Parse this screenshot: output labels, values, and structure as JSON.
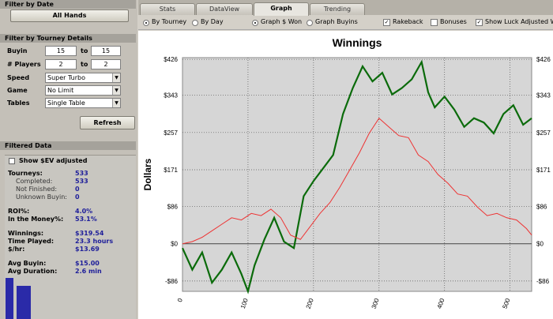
{
  "left": {
    "filter_date_title": "Filter by Date",
    "all_hands_label": "All Hands",
    "tourney_title": "Filter by Tourney Details",
    "buyin_label": "Buyin",
    "buyin_from": "15",
    "buyin_to_label": "to",
    "buyin_to": "15",
    "players_label": "# Players",
    "players_from": "2",
    "players_to_label": "to",
    "players_to": "2",
    "speed_label": "Speed",
    "speed_value": "Super Turbo",
    "game_label": "Game",
    "game_value": "No Limit",
    "tables_label": "Tables",
    "tables_value": "Single Table",
    "refresh_label": "Refresh",
    "filtered_title": "Filtered Data",
    "show_ev_label": "Show $EV adjusted",
    "stats": {
      "tourneys_label": "Tourneys:",
      "tourneys": "533",
      "completed_label": "Completed:",
      "completed": "533",
      "not_finished_label": "Not Finished:",
      "not_finished": "0",
      "unknown_label": "Unknown Buyin:",
      "unknown": "0",
      "roi_label": "ROI%:",
      "roi": "4.0%",
      "itm_label": "In the Money%:",
      "itm": "53.1%",
      "winnings_label": "Winnings:",
      "winnings": "$319.54",
      "time_label": "Time Played:",
      "time": "23.3 hours",
      "hr_label": "$/hr:",
      "hr": "$13.69",
      "avg_buyin_label": "Avg Buyin:",
      "avg_buyin": "$15.00",
      "avg_dur_label": "Avg Duration:",
      "avg_dur": "2.6 min"
    }
  },
  "tabs": [
    "Stats",
    "DataView",
    "Graph",
    "Trending"
  ],
  "options": {
    "by_tourney": "By Tourney",
    "by_day": "By Day",
    "graph_won": "Graph $ Won",
    "graph_buyins": "Graph Buyins",
    "rakeback": "Rakeback",
    "bonuses": "Bonuses",
    "luck": "Show Luck Adjusted Wi"
  },
  "colors": {
    "won": "#0b6b0b",
    "luck": "#ee3333",
    "zero": "#555555"
  },
  "chart_data": {
    "type": "line",
    "title": "Winnings",
    "ylabel": "Dollars",
    "xlim": [
      0,
      533
    ],
    "ylim": [
      -110,
      430
    ],
    "y_ticks": [
      -86,
      0,
      86,
      171,
      257,
      343,
      426
    ],
    "y_tick_labels": [
      "-$86",
      "$0",
      "$86",
      "$171",
      "$257",
      "$343",
      "$426"
    ],
    "x_ticks": [
      0,
      100,
      200,
      300,
      400,
      500
    ],
    "x_tick_labels": [
      "0",
      "100",
      "200",
      "300",
      "400",
      "500"
    ],
    "series": [
      {
        "color": "#0b6b0b",
        "x": [
          0,
          15,
          30,
          45,
          60,
          75,
          90,
          100,
          110,
          125,
          140,
          155,
          170,
          185,
          200,
          215,
          230,
          245,
          260,
          275,
          290,
          305,
          320,
          335,
          350,
          365,
          375,
          385,
          400,
          415,
          430,
          445,
          460,
          475,
          490,
          505,
          520,
          533
        ],
        "y": [
          -10,
          -60,
          -20,
          -90,
          -60,
          -20,
          -70,
          -110,
          -50,
          10,
          60,
          5,
          -10,
          110,
          145,
          175,
          205,
          300,
          360,
          410,
          375,
          395,
          345,
          360,
          380,
          420,
          350,
          315,
          340,
          310,
          270,
          290,
          280,
          255,
          300,
          320,
          275,
          290
        ]
      },
      {
        "color": "#ee3333",
        "x": [
          0,
          15,
          30,
          45,
          60,
          75,
          90,
          105,
          120,
          135,
          150,
          165,
          180,
          195,
          210,
          225,
          240,
          255,
          270,
          285,
          300,
          315,
          330,
          345,
          360,
          375,
          390,
          405,
          420,
          435,
          450,
          465,
          480,
          495,
          510,
          525,
          533
        ],
        "y": [
          0,
          5,
          15,
          30,
          45,
          60,
          55,
          70,
          65,
          80,
          60,
          20,
          10,
          40,
          70,
          95,
          130,
          170,
          210,
          255,
          290,
          270,
          250,
          245,
          205,
          190,
          160,
          140,
          115,
          110,
          85,
          65,
          70,
          60,
          55,
          35,
          20
        ]
      }
    ]
  }
}
